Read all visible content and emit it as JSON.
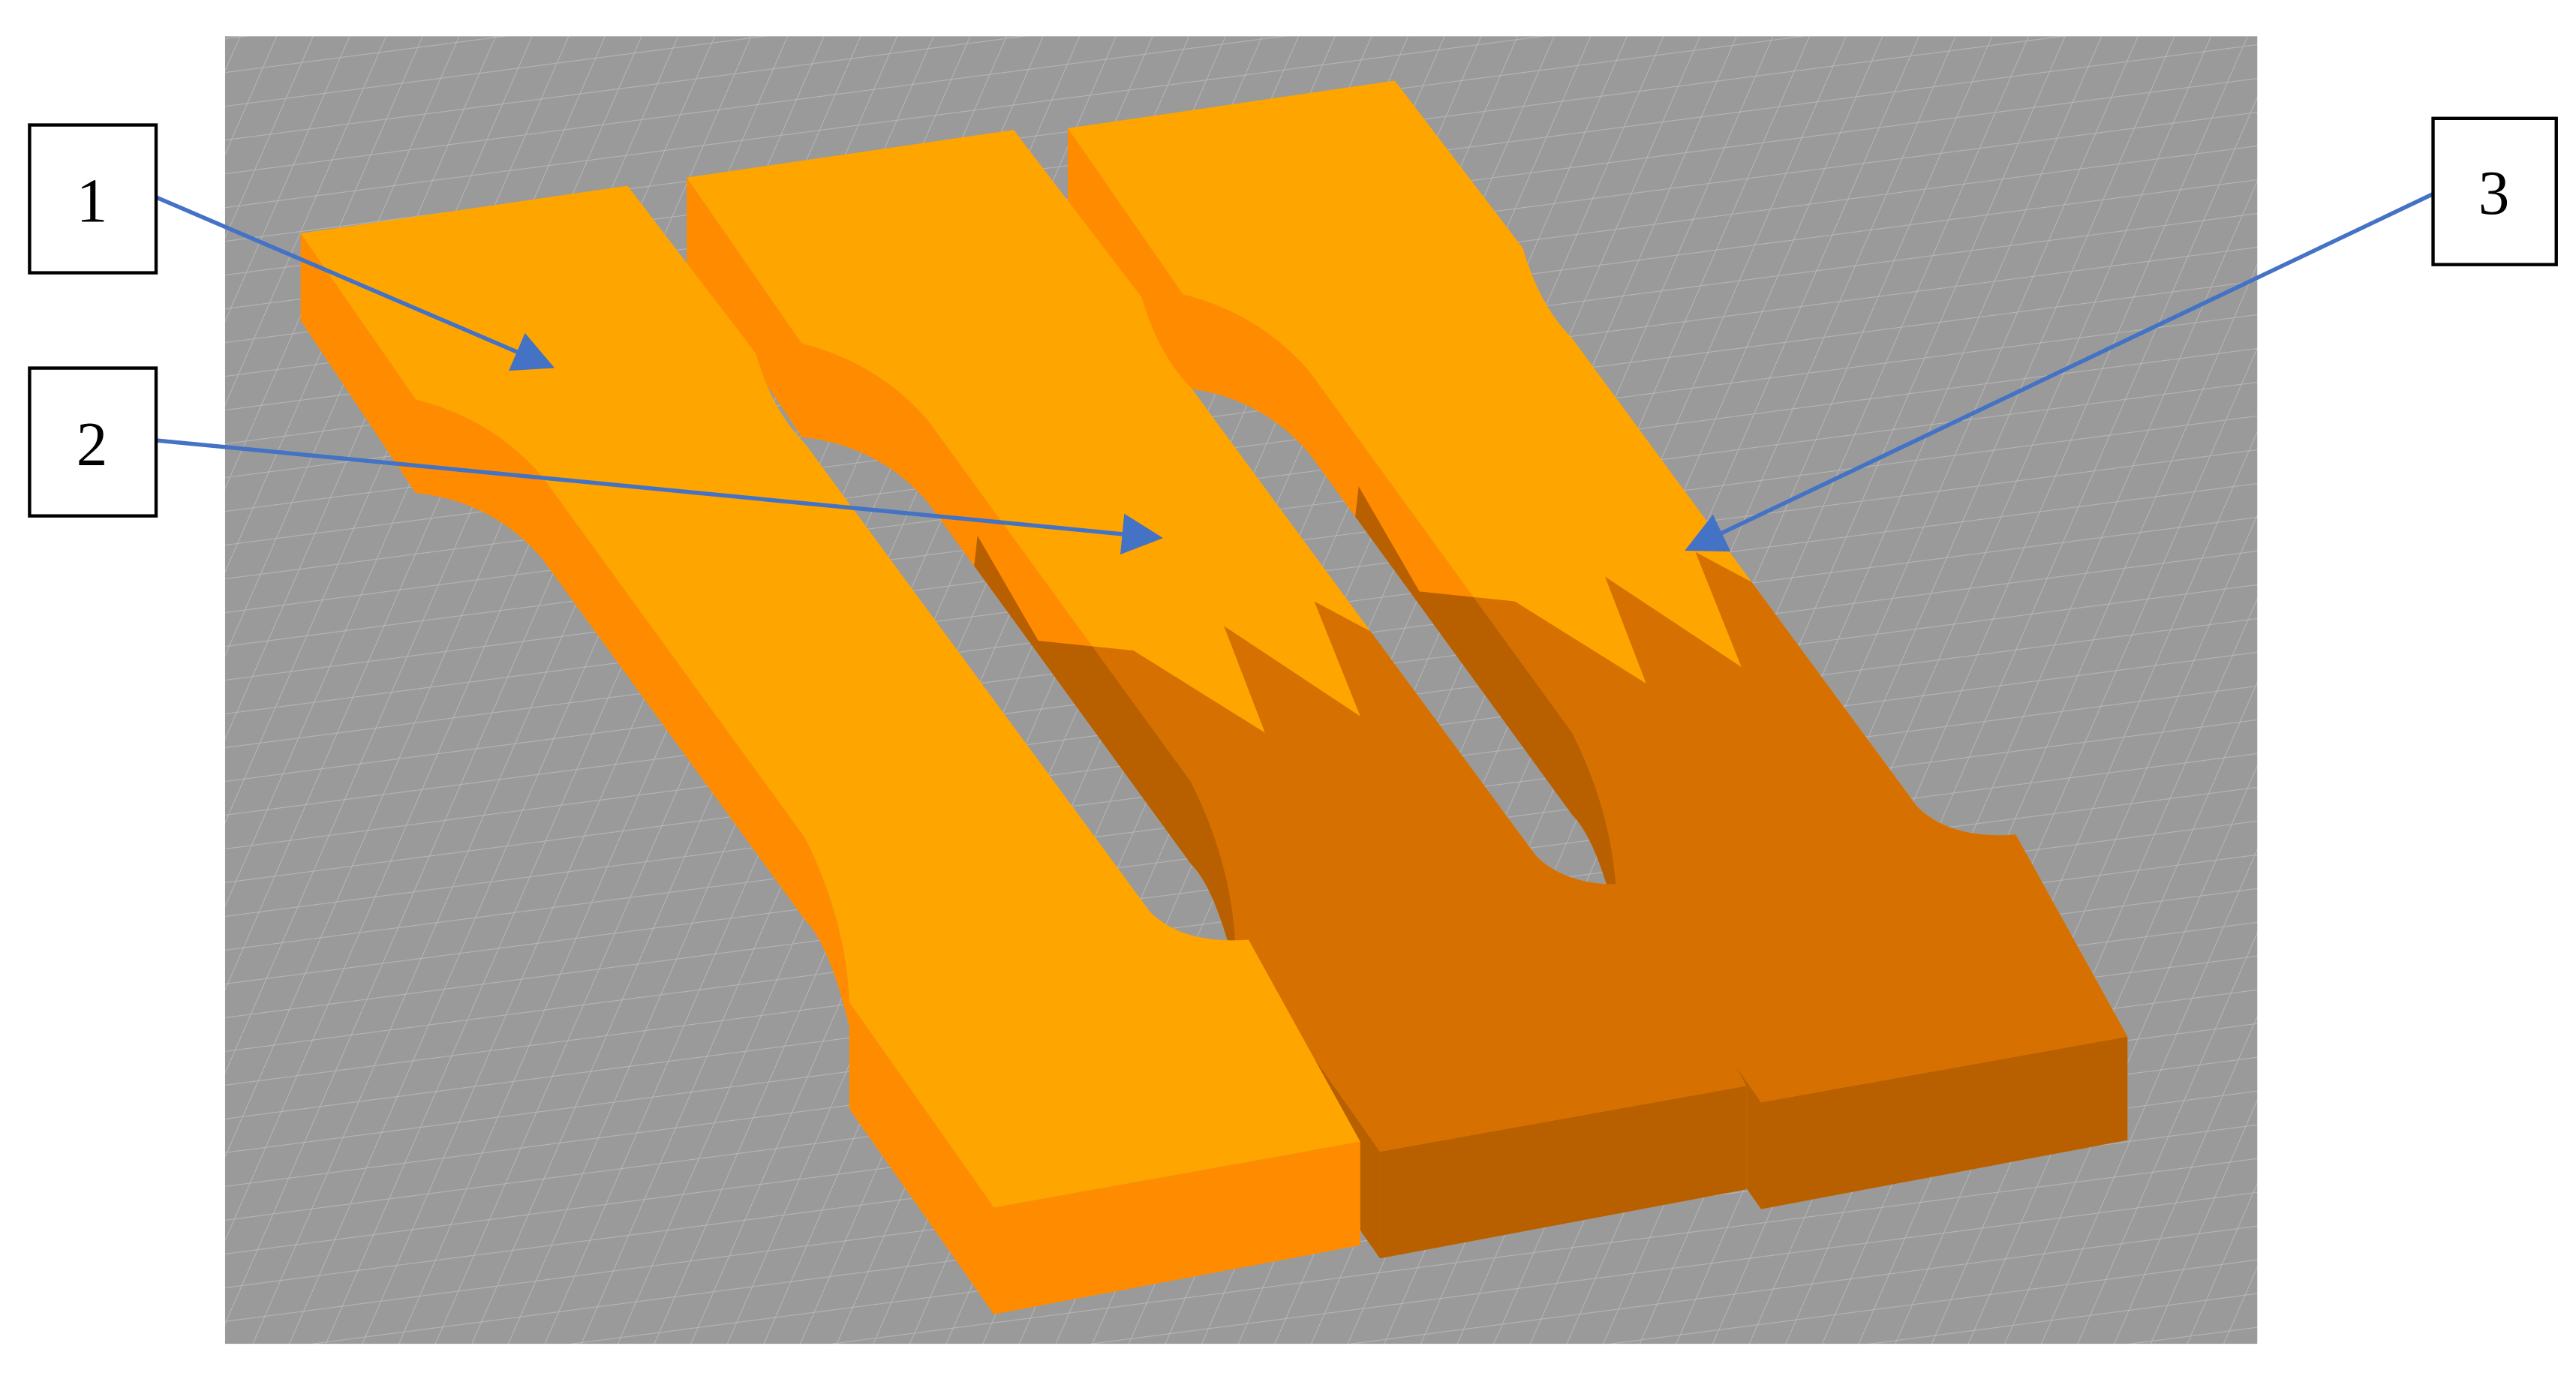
{
  "figure": {
    "labels": [
      {
        "text": "1",
        "target": "specimen-1"
      },
      {
        "text": "2",
        "target": "specimen-2"
      },
      {
        "text": "3",
        "target": "specimen-3"
      }
    ],
    "colors": {
      "background": "#9a9a9a",
      "grid": "#b4b4b4",
      "top_light": "#FFA500",
      "side_light": "#FF8C00",
      "top_dark": "#D67000",
      "side_dark": "#B85F00",
      "arrow": "#4472C4"
    }
  }
}
